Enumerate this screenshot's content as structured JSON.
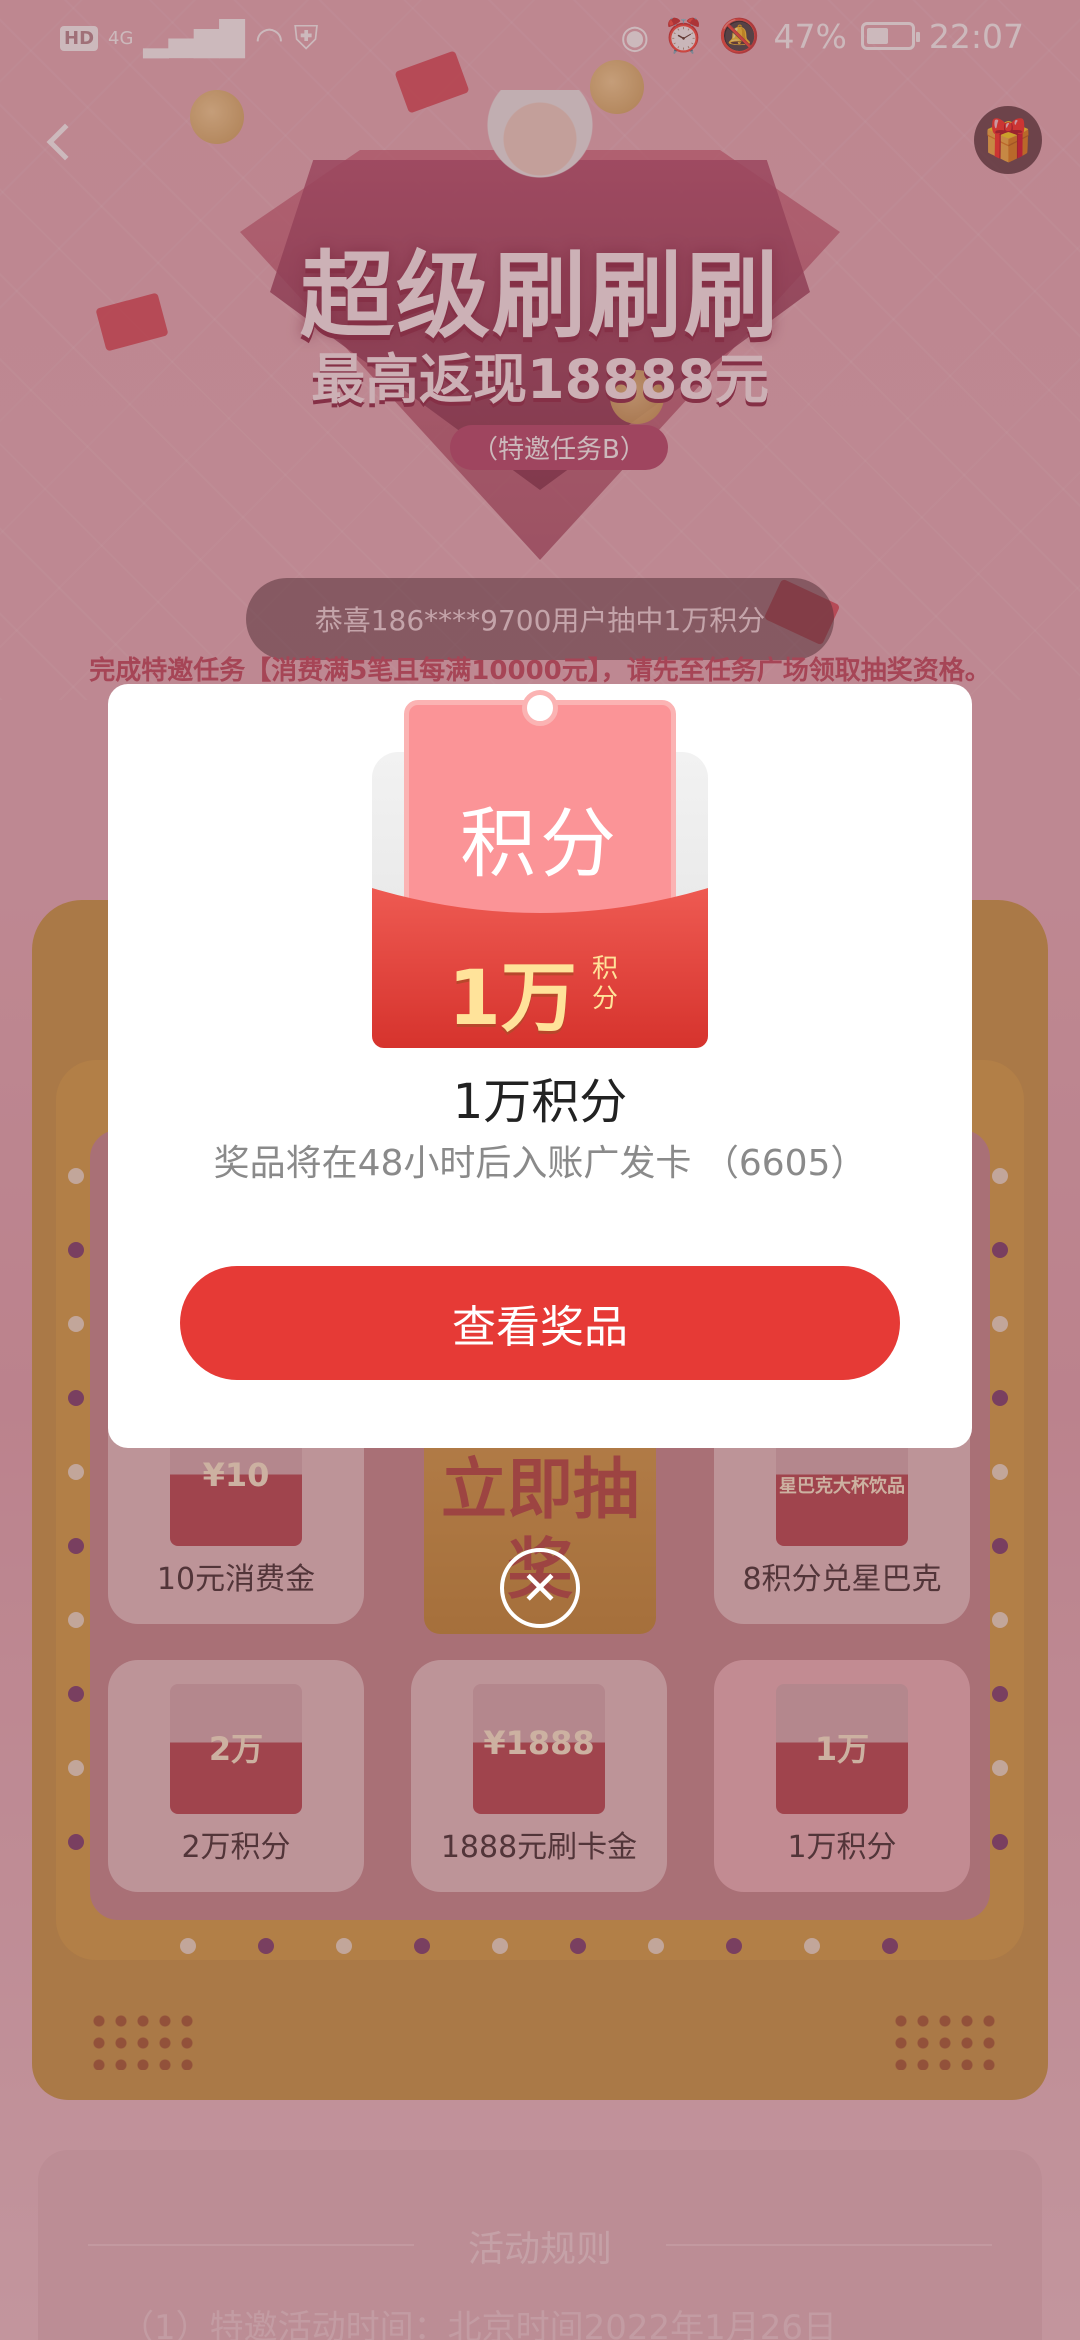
{
  "status_bar": {
    "left_badge": "HD",
    "network": "4G",
    "battery_percent": "47%",
    "battery_level": 0.47,
    "time": "22:07"
  },
  "hero": {
    "title": "超级刷刷刷",
    "subtitle": "最高返现18888元",
    "tag": "（特邀任务B）"
  },
  "winner_toast": "恭喜186****9700用户抽中1万积分",
  "notice": "完成特邀任务【消费满5笔且每满10000元】，请先至任务广场领取抽奖资格。",
  "board": {
    "prizes": [
      {
        "image_text": "¥10",
        "label": "10元消费金"
      },
      {
        "image_text": "星巴克大杯饮品",
        "label": "8积分兑星巴克"
      },
      {
        "image_text": "2万",
        "label": "2万积分"
      },
      {
        "image_text": "¥1888",
        "label": "1888元刷卡金"
      },
      {
        "image_text": "1万",
        "label": "1万积分"
      }
    ],
    "draw_button": "立即抽奖"
  },
  "rules": {
    "title": "活动规则",
    "line1": "（1）特邀活动时间：北京时间2022年1月26日"
  },
  "dialog": {
    "card_title": "积分",
    "card_amount": "1万",
    "card_unit": "积分",
    "title": "1万积分",
    "description": "奖品将在48小时后入账广发卡 （6605）",
    "primary_button": "查看奖品"
  },
  "icons": {
    "back": "chevron-left-icon",
    "gift": "gift-icon",
    "close": "close-circle-icon"
  },
  "colors": {
    "primary_button": "#e63a36",
    "notice_text": "#c2445b",
    "card_gold": "#ffe39a"
  }
}
